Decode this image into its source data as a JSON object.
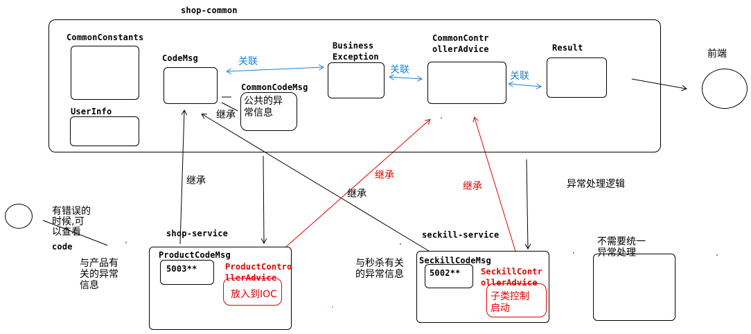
{
  "modules": {
    "shop_common": "shop-common",
    "shop_service": "shop-service",
    "seckill_service": "seckill-service"
  },
  "common": {
    "common_constants": "CommonConstants",
    "user_info": "UserInfo",
    "code_msg": "CodeMsg",
    "common_code_msg": "CommonCodeMsg",
    "common_code_msg_desc": "公共的异\n常信息",
    "business_exception": "Business\nException",
    "controller_advice": "CommonContr\nollerAdvice",
    "result": "Result"
  },
  "frontend": "前端",
  "relations": {
    "assoc_1": "关联",
    "assoc_2": "关联",
    "assoc_3": "关联",
    "inherit_common": "继承",
    "inherit_product": "继承",
    "inherit_seckill_codemsg": "继承",
    "inherit_product_advice": "继承",
    "inherit_seckill_advice": "继承",
    "exception_logic": "异常处理逻辑"
  },
  "notes": {
    "error_code": "有错误的\n时候,可\n以查看",
    "error_code_word": "code",
    "product_info": "与产品有\n关的异常\n信息",
    "seckill_info": "与秒杀有关\n的异常信息",
    "no_unify": "不需要统一\n异常处理"
  },
  "shop_service": {
    "product_code_msg": "ProductCodeMsg",
    "code": "5003**",
    "advice": "ProductContro\nllerAdvice",
    "advice_note": "放入到IOC"
  },
  "seckill_service": {
    "seckill_code_msg": "SeckillCodeMsg",
    "code": "5002**",
    "advice": "SeckillContr\nollerAdvice",
    "advice_note": "子类控制\n启动"
  },
  "colors": {
    "assoc": "#1a7fd6",
    "inherit_red": "#e00000",
    "line": "#000000"
  }
}
